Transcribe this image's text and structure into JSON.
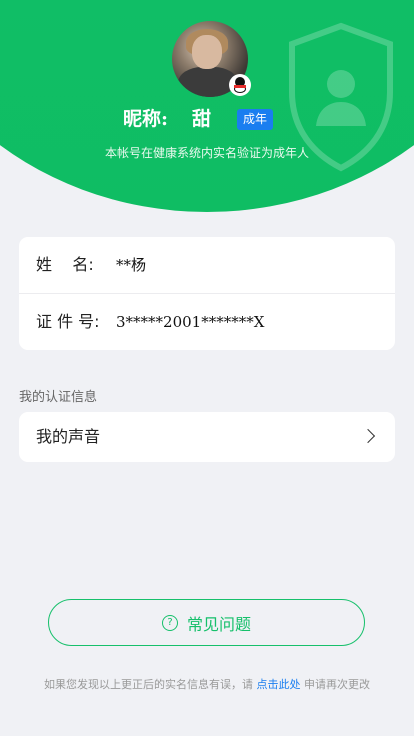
{
  "header": {
    "nickname_label": "昵称:",
    "nickname_value": "甜",
    "adult_badge": "成年",
    "verify_note": "本帐号在健康系统内实名验证为成年人"
  },
  "identity": {
    "name_label": "姓    名:",
    "name_value": "**杨",
    "id_label": "证 件 号:",
    "id_value": "3*****2001*******X"
  },
  "certification": {
    "section_title": "我的认证信息",
    "voice_label": "我的声音"
  },
  "faq": {
    "label": "常见问题",
    "icon_glyph": "?"
  },
  "footer": {
    "prefix": "如果您发现以上更正后的实名信息有误，请 ",
    "link": "点击此处",
    "suffix": " 申请再次更改"
  },
  "colors": {
    "brand_green": "#16c06b",
    "badge_blue": "#1a7ef0",
    "background": "#f0f1f5"
  },
  "icons": [
    "shield-user-icon",
    "qq-penguin-icon",
    "chevron-right-icon",
    "question-circle-icon"
  ]
}
